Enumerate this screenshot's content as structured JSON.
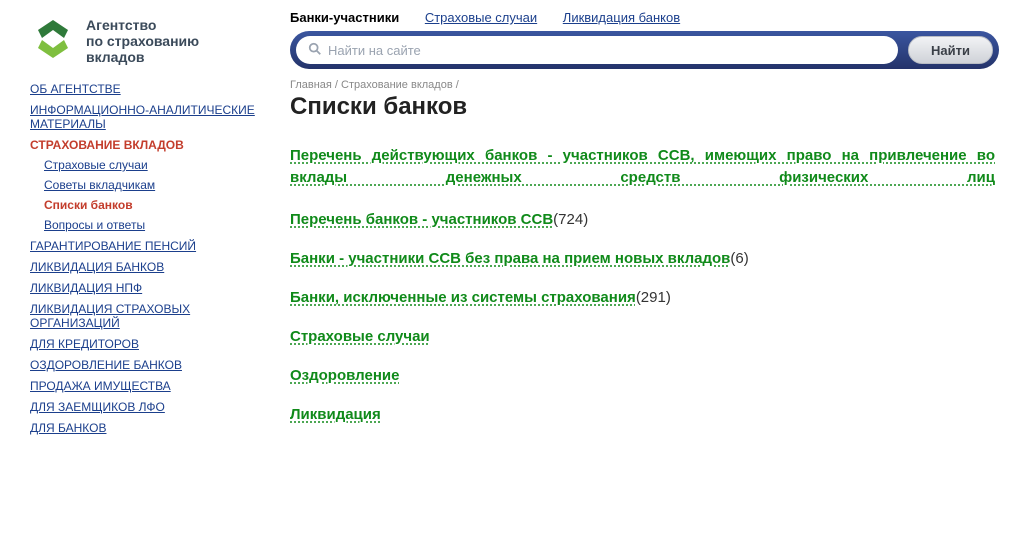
{
  "logo": {
    "line1": "Агентство",
    "line2": "по страхованию",
    "line3": "вкладов"
  },
  "search": {
    "placeholder": "Найти на сайте",
    "button": "Найти"
  },
  "tabs": {
    "t0": "Банки-участники",
    "t1": "Страховые случаи",
    "t2": "Ликвидация банков"
  },
  "breadcrumb": "Главная / Страхование вкладов /",
  "page_title": "Списки банков",
  "nav": {
    "about": "ОБ АГЕНТСТВЕ",
    "info": "ИНФОРМАЦИОННО-АНАЛИТИЧЕСКИЕ МАТЕРИАЛЫ",
    "insurance": "СТРАХОВАНИЕ ВКЛАДОВ",
    "sub": {
      "cases": "Страховые случаи",
      "advice": "Советы вкладчикам",
      "lists": "Списки банков",
      "qna": "Вопросы и ответы"
    },
    "pensions": "ГАРАНТИРОВАНИЕ ПЕНСИЙ",
    "bankliq": "ЛИКВИДАЦИЯ БАНКОВ",
    "npfliq": "ЛИКВИДАЦИЯ НПФ",
    "insorgliq": "ЛИКВИДАЦИЯ СТРАХОВЫХ ОРГАНИЗАЦИЙ",
    "creditors": "ДЛЯ КРЕДИТОРОВ",
    "rehab": "ОЗДОРОВЛЕНИЕ БАНКОВ",
    "sales": "ПРОДАЖА ИМУЩЕСТВА",
    "lfo": "ДЛЯ ЗАЕМЩИКОВ ЛФО",
    "forbanks": "ДЛЯ БАНКОВ"
  },
  "content": {
    "c0": "Перечень действующих банков - участников ССВ, имеющих право на привлечение во вклады денежных средств физических лиц",
    "c1": {
      "label": "Перечень банков - участников ССВ",
      "count": "(724)"
    },
    "c2": {
      "label": "Банки - участники ССВ без права на прием новых вкладов",
      "count": "(6)"
    },
    "c3": {
      "label": "Банки, исключенные из системы страхования",
      "count": "(291)"
    },
    "c4": "Страховые случаи",
    "c5": "Оздоровление",
    "c6": "Ликвидация"
  }
}
